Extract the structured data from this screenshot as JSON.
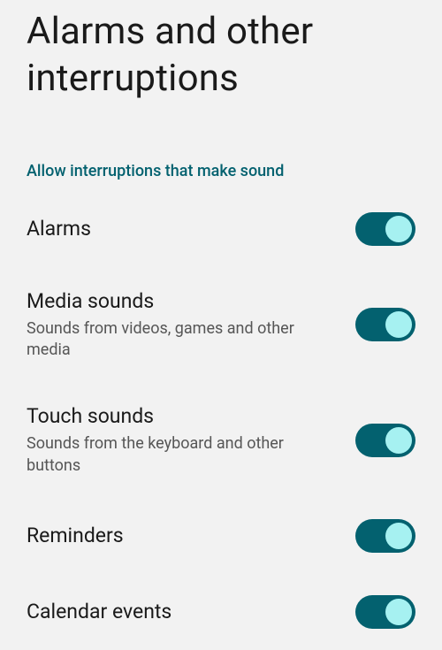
{
  "page": {
    "title": "Alarms and other interruptions"
  },
  "section": {
    "header": "Allow interruptions that make sound"
  },
  "settings": {
    "alarms": {
      "title": "Alarms",
      "subtitle": "",
      "on": true
    },
    "media_sounds": {
      "title": "Media sounds",
      "subtitle": "Sounds from videos, games and other media",
      "on": true
    },
    "touch_sounds": {
      "title": "Touch sounds",
      "subtitle": "Sounds from the keyboard and other buttons",
      "on": true
    },
    "reminders": {
      "title": "Reminders",
      "subtitle": "",
      "on": true
    },
    "calendar_events": {
      "title": "Calendar events",
      "subtitle": "",
      "on": true
    }
  },
  "colors": {
    "accent": "#03616f",
    "thumb_on": "#a6f1f1",
    "bg": "#f2f2f2"
  }
}
